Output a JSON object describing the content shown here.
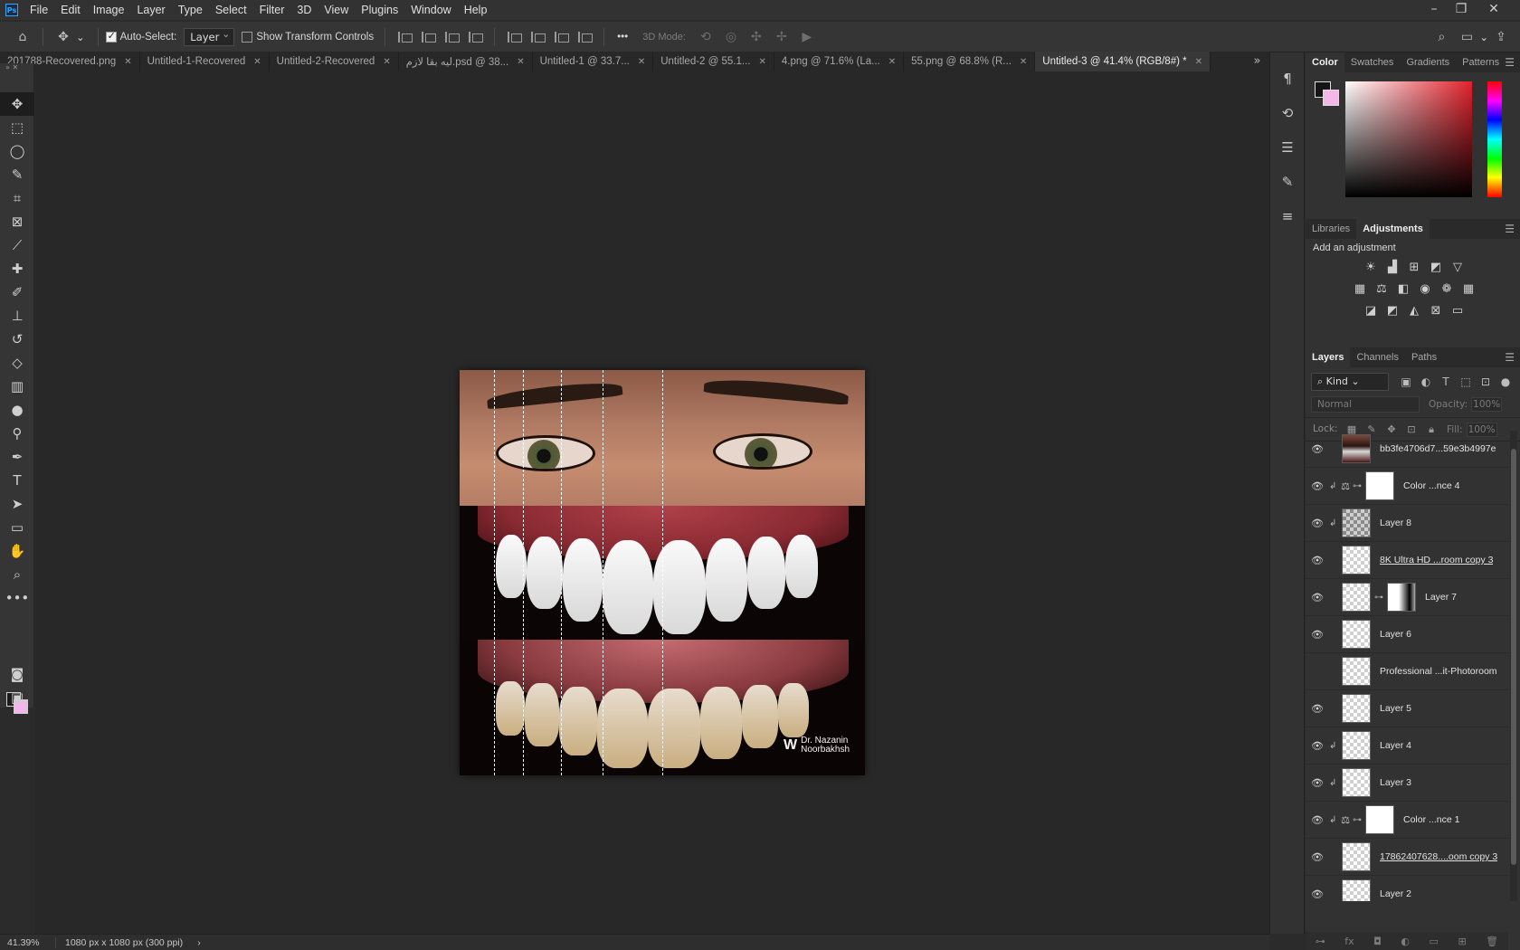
{
  "menubar": {
    "logo": "Ps",
    "items": [
      "File",
      "Edit",
      "Image",
      "Layer",
      "Type",
      "Select",
      "Filter",
      "3D",
      "View",
      "Plugins",
      "Window",
      "Help"
    ]
  },
  "options": {
    "auto_select_label": "Auto-Select:",
    "auto_select_value": "Layer",
    "show_transform_label": "Show Transform Controls",
    "mode3d_label": "3D Mode:",
    "more_label": "•••"
  },
  "tabs": [
    {
      "label": "201788-Recovered.png",
      "active": false
    },
    {
      "label": "Untitled-1-Recovered",
      "active": false
    },
    {
      "label": "Untitled-2-Recovered",
      "active": false
    },
    {
      "label": "لیه بقا لازم.psd @ 38...",
      "active": false
    },
    {
      "label": "Untitled-1 @ 33.7...",
      "active": false
    },
    {
      "label": "Untitled-2 @ 55.1...",
      "active": false
    },
    {
      "label": "4.png @ 71.6% (La...",
      "active": false
    },
    {
      "label": "55.png @ 68.8% (R...",
      "active": false
    },
    {
      "label": "Untitled-3 @ 41.4% (RGB/8#) *",
      "active": true
    }
  ],
  "document": {
    "watermark_line1": "Dr. Nazanin",
    "watermark_line2": "Noorbakhsh"
  },
  "color_panel": {
    "tabs": [
      "Color",
      "Swatches",
      "Gradients",
      "Patterns"
    ],
    "active": "Color",
    "foreground": "#151515",
    "background": "#f5b6ea"
  },
  "adjustments_panel": {
    "tabs": [
      "Libraries",
      "Adjustments"
    ],
    "active": "Adjustments",
    "title": "Add an adjustment"
  },
  "layers_panel": {
    "tabs": [
      "Layers",
      "Channels",
      "Paths"
    ],
    "active": "Layers",
    "kind": "Kind",
    "blend_mode": "Normal",
    "opacity_label": "Opacity:",
    "opacity_value": "100%",
    "lock_label": "Lock:",
    "fill_label": "Fill:",
    "fill_value": "100%",
    "layers": [
      {
        "name": "bb3fe4706d7...59e3b4997e",
        "visible": true,
        "thumb": "photo",
        "clip": false,
        "adj": false,
        "mask": false,
        "smart": false
      },
      {
        "name": "Color ...nce 4",
        "visible": true,
        "thumb": "white",
        "clip": true,
        "adj": true,
        "mask": false,
        "smart": false
      },
      {
        "name": "Layer 8",
        "visible": true,
        "thumb": "grey",
        "clip": true,
        "adj": false,
        "mask": false,
        "smart": false
      },
      {
        "name": "8K Ultra HD ...room copy 3",
        "visible": true,
        "thumb": "checker",
        "clip": false,
        "adj": false,
        "mask": false,
        "smart": true
      },
      {
        "name": "Layer 7",
        "visible": true,
        "thumb": "checker",
        "clip": false,
        "adj": false,
        "mask": true,
        "smart": false
      },
      {
        "name": "Layer 6",
        "visible": true,
        "thumb": "checker",
        "clip": false,
        "adj": false,
        "mask": false,
        "smart": false
      },
      {
        "name": "Professional ...it-Photoroom",
        "visible": false,
        "thumb": "checker",
        "clip": false,
        "adj": false,
        "mask": false,
        "smart": false
      },
      {
        "name": "Layer 5",
        "visible": true,
        "thumb": "checker",
        "clip": false,
        "adj": false,
        "mask": false,
        "smart": false
      },
      {
        "name": "Layer 4",
        "visible": true,
        "thumb": "checker",
        "clip": true,
        "adj": false,
        "mask": false,
        "smart": false
      },
      {
        "name": "Layer 3",
        "visible": true,
        "thumb": "checker",
        "clip": true,
        "adj": false,
        "mask": false,
        "smart": false
      },
      {
        "name": "Color ...nce 1",
        "visible": true,
        "thumb": "white",
        "clip": true,
        "adj": true,
        "mask": false,
        "smart": false
      },
      {
        "name": "17862407628....oom copy 3",
        "visible": true,
        "thumb": "checker",
        "clip": false,
        "adj": false,
        "mask": false,
        "smart": true
      },
      {
        "name": "Layer 2",
        "visible": true,
        "thumb": "checker",
        "clip": false,
        "adj": false,
        "mask": false,
        "smart": false
      }
    ]
  },
  "status": {
    "zoom": "41.39%",
    "dimensions": "1080 px x 1080 px (300 ppi)"
  }
}
